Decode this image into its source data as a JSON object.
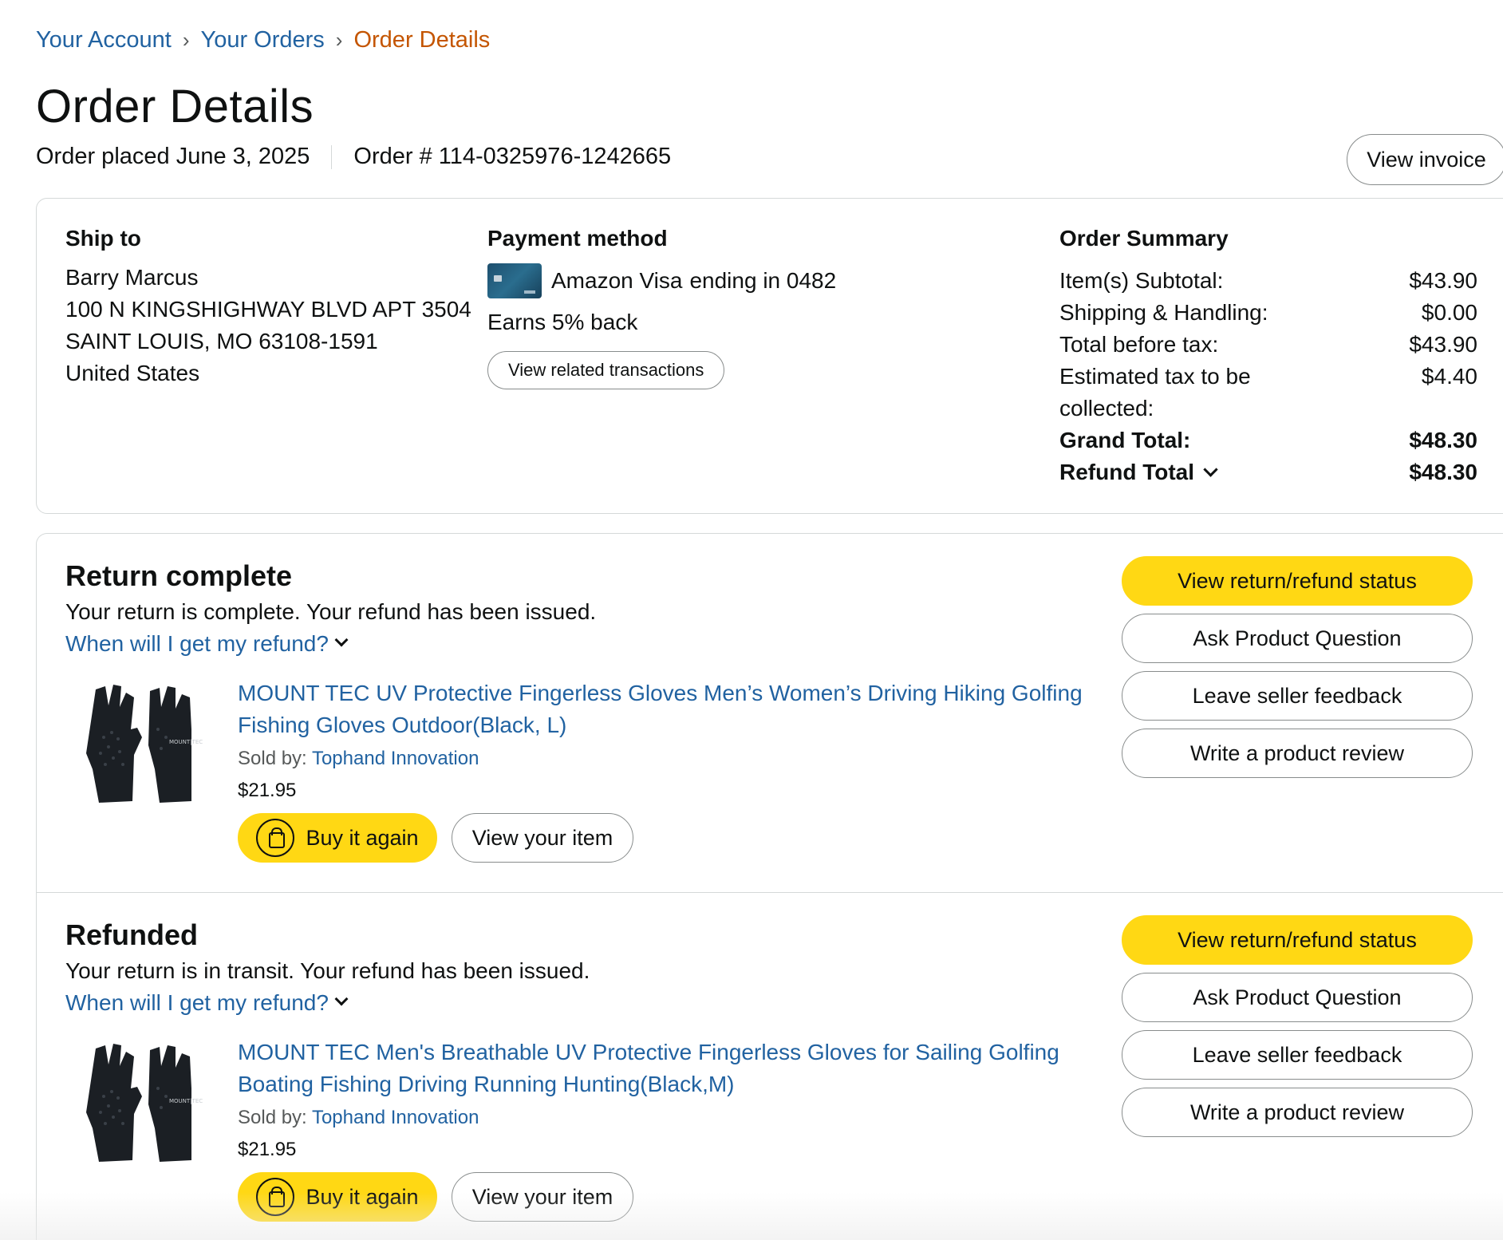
{
  "breadcrumb": {
    "account": "Your Account",
    "orders": "Your Orders",
    "current": "Order Details",
    "separator": "›"
  },
  "page_title": "Order Details",
  "order_meta": {
    "placed": "Order placed June 3, 2025",
    "number": "Order # 114-0325976-1242665"
  },
  "invoice_button": "View invoice",
  "ship_to": {
    "heading": "Ship to",
    "name": "Barry Marcus",
    "line1": "100 N KINGSHIGHWAY BLVD APT 3504",
    "line2": "SAINT LOUIS, MO 63108-1591",
    "country": "United States"
  },
  "payment": {
    "heading": "Payment method",
    "card": "Amazon Visa",
    "ending": "ending in 0482",
    "earns": "Earns 5% back",
    "transactions_button": "View related transactions"
  },
  "summary": {
    "heading": "Order Summary",
    "rows": [
      {
        "label": "Item(s) Subtotal:",
        "value": "$43.90"
      },
      {
        "label": "Shipping & Handling:",
        "value": "$0.00"
      },
      {
        "label": "Total before tax:",
        "value": "$43.90"
      },
      {
        "label": "Estimated tax to be collected:",
        "value": "$4.40"
      },
      {
        "label": "Grand Total:",
        "value": "$48.30"
      },
      {
        "label": "Refund Total",
        "value": "$48.30"
      }
    ]
  },
  "shipments": [
    {
      "status": "Return complete",
      "description": "Your return is complete. Your refund has been issued.",
      "refund_link": "When will I get my refund?",
      "product": {
        "title": "MOUNT TEC UV Protective Fingerless Gloves Men’s Women’s Driving Hiking Golfing Fishing Gloves Outdoor(Black, L)",
        "sold_by_label": "Sold by:",
        "seller": "Tophand Innovation",
        "price": "$21.95",
        "glove_brand": "MOUNT|TEC"
      },
      "buy_again": "Buy it again",
      "view_item": "View your item",
      "actions": [
        "View return/refund status",
        "Ask Product Question",
        "Leave seller feedback",
        "Write a product review"
      ]
    },
    {
      "status": "Refunded",
      "description": "Your return is in transit. Your refund has been issued.",
      "refund_link": "When will I get my refund?",
      "product": {
        "title": "MOUNT TEC Men's Breathable UV Protective Fingerless Gloves for Sailing Golfing Boating Fishing Driving Running Hunting(Black,M)",
        "sold_by_label": "Sold by:",
        "seller": "Tophand Innovation",
        "price": "$21.95",
        "glove_brand": "MOUNT|TEC"
      },
      "buy_again": "Buy it again",
      "view_item": "View your item",
      "actions": [
        "View return/refund status",
        "Ask Product Question",
        "Leave seller feedback",
        "Write a product review"
      ]
    }
  ],
  "colors": {
    "link": "#2162a1",
    "breadcrumb_current": "#c45500",
    "primary_button": "#ffd814",
    "border": "#d5d9d9"
  }
}
